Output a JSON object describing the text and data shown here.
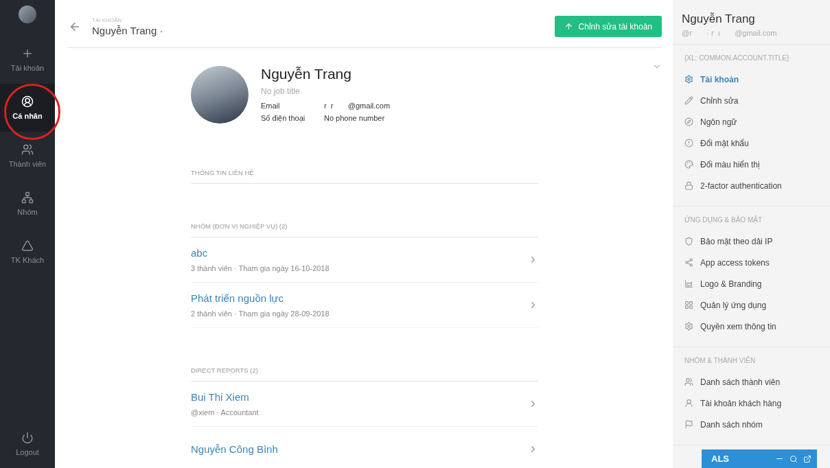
{
  "nav": {
    "items": [
      {
        "label": "Tài khoản",
        "selected": false
      },
      {
        "label": "Cá nhân",
        "selected": true
      },
      {
        "label": "Thành viên",
        "selected": false
      },
      {
        "label": "Nhóm",
        "selected": false
      },
      {
        "label": "TK Khách",
        "selected": false
      }
    ],
    "logout": "Logout"
  },
  "header": {
    "breadcrumb": "TÀI KHOẢN",
    "title": "Nguyễn Trang ·",
    "edit_button": "Chỉnh sửa tài khoản"
  },
  "profile": {
    "name": "Nguyễn Trang",
    "job_title": "No job title",
    "fields": [
      {
        "label": "Email",
        "value": "r  r       @gmail.com"
      },
      {
        "label": "Số điện thoại",
        "value": "No phone number"
      }
    ]
  },
  "sections": [
    {
      "title": "THÔNG TIN LIÊN HỆ"
    },
    {
      "title": "NHÓM (ĐƠN VỊ NGHIỆP VỤ) (2)",
      "items": [
        {
          "title": "abc",
          "subtitle": "3 thành viên · Tham gia ngày 16-10-2018"
        },
        {
          "title": "Phát triển nguồn lực",
          "subtitle": "2 thành viên · Tham gia ngày 28-09-2018"
        }
      ]
    },
    {
      "title": "DIRECT REPORTS (2)",
      "items": [
        {
          "title": "Bui Thi Xiem",
          "subtitle": "@xiem · Accountant"
        },
        {
          "title": "Nguyễn Công Bình"
        }
      ]
    }
  ],
  "right_panel": {
    "name": "Nguyễn Trang",
    "email": "@r       · r  ı       @gmail.com",
    "groups": [
      {
        "title": "{XL: COMMON.ACCOUNT.TITLE}",
        "items": [
          {
            "label": "Tài khoản",
            "selected": true
          },
          {
            "label": "Chỉnh sửa",
            "selected": false
          },
          {
            "label": "Ngôn ngữ",
            "selected": false
          },
          {
            "label": "Đổi mật khẩu",
            "selected": false
          },
          {
            "label": "Đổi màu hiển thị",
            "selected": false
          },
          {
            "label": "2-factor authentication",
            "selected": false
          }
        ]
      },
      {
        "title": "ỨNG DỤNG & BẢO MẬT",
        "items": [
          {
            "label": "Bảo mật theo dải IP",
            "selected": false
          },
          {
            "label": "App access tokens",
            "selected": false
          },
          {
            "label": "Logo & Branding",
            "selected": false
          },
          {
            "label": "Quản lý ứng dụng",
            "selected": false
          },
          {
            "label": "Quyền xem thông tin",
            "selected": false
          }
        ]
      },
      {
        "title": "NHÓM & THÀNH VIÊN",
        "items": [
          {
            "label": "Danh sách thành viên",
            "selected": false
          },
          {
            "label": "Tài khoản khách hàng",
            "selected": false
          },
          {
            "label": "Danh sách nhóm",
            "selected": false
          }
        ]
      }
    ]
  },
  "chat_widget": {
    "title": "ALS"
  }
}
